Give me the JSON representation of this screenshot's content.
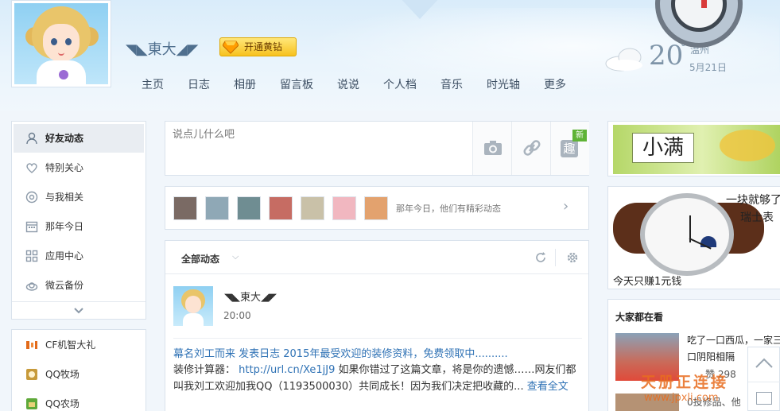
{
  "header": {
    "user_name": "◥◣東大◢◤",
    "vip_label": "开通黄钻",
    "nav": [
      "主页",
      "日志",
      "相册",
      "留言板",
      "说说",
      "个人档",
      "音乐",
      "时光轴",
      "更多"
    ]
  },
  "weather": {
    "temp": "20",
    "deg": "°",
    "city": "温州",
    "date": "5月21日",
    "icon": "cloud-icon"
  },
  "sidebar": {
    "items": [
      {
        "label": "好友动态",
        "icon": "friends-icon",
        "active": true
      },
      {
        "label": "特别关心",
        "icon": "heart-icon"
      },
      {
        "label": "与我相关",
        "icon": "at-icon"
      },
      {
        "label": "那年今日",
        "icon": "calendar-icon"
      },
      {
        "label": "应用中心",
        "icon": "apps-icon"
      },
      {
        "label": "微云备份",
        "icon": "cloud-backup-icon"
      }
    ],
    "collapse_icon": "chevron-down-icon",
    "apps": [
      {
        "label": "CF机智大礼",
        "icon": "cf-icon"
      },
      {
        "label": "QQ牧场",
        "icon": "ranch-icon"
      },
      {
        "label": "QQ农场",
        "icon": "farm-icon"
      }
    ]
  },
  "composer": {
    "placeholder": "说点儿什么吧",
    "tools": [
      "camera-icon",
      "link-icon",
      "fun-icon"
    ],
    "fun_label": "趣",
    "new_badge": "新"
  },
  "year_today": {
    "text": "那年今日，他们有精彩动态",
    "arrow": "›"
  },
  "feed": {
    "filter": "全部动态",
    "filter_arrow": "⌵",
    "post": {
      "author": "◥◣東大◢◤",
      "time": "20:00",
      "line1": "幕名刘工而来  发表日志  2015年最受欢迎的装修资料，免费领取中..........",
      "text_prefix": "装修计算器：",
      "url": "http://url.cn/Xe1jJ9",
      "text_body": " 如果你错过了这篇文章，将是你的遗憾……网友们都叫我刘工欢迎加我QQ（1193500030）共同成长！因为我们决定把收藏的...",
      "more": "查看全文"
    }
  },
  "right": {
    "ad1_title": "小满",
    "ad2_line1": "一块就够了",
    "ad2_line2": "瑞士表",
    "ad2_line3": "今天只赚1元钱",
    "hot_title": "大家都在看",
    "hot_t1": "吃了一口西瓜，一家三",
    "hot_t2": "口阴阳相隔",
    "hot_like": "赞 298",
    "hot_t3": "0投修品、他"
  },
  "watermark": {
    "text": "天册正连接",
    "url": "www.jpxli.com"
  }
}
